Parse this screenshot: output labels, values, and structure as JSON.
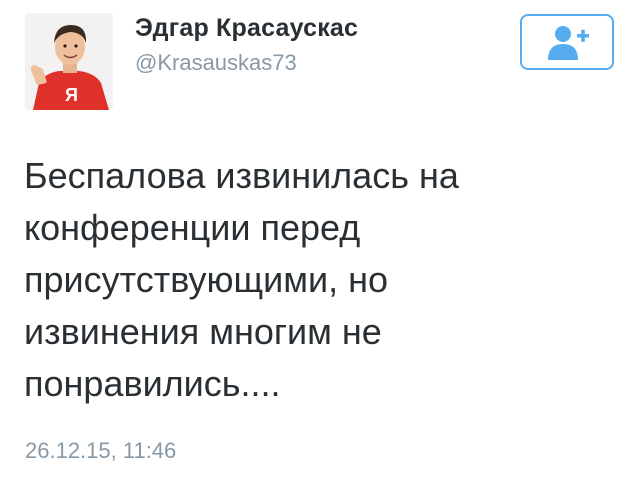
{
  "user": {
    "display_name": "Эдгар Красаускас",
    "handle": "@Krasauskas73"
  },
  "follow_button": {
    "icon": "add-user-icon",
    "color": "#55acee"
  },
  "tweet": {
    "lines": [
      "Беспалова извинилась на",
      "конференции перед",
      "присутствующими, но",
      "извинения многим не",
      "понравились...."
    ],
    "timestamp": "26.12.15, 11:46"
  },
  "colors": {
    "text": "#292f33",
    "muted": "#8899a6",
    "accent": "#55acee",
    "shirt": "#e0302a"
  }
}
